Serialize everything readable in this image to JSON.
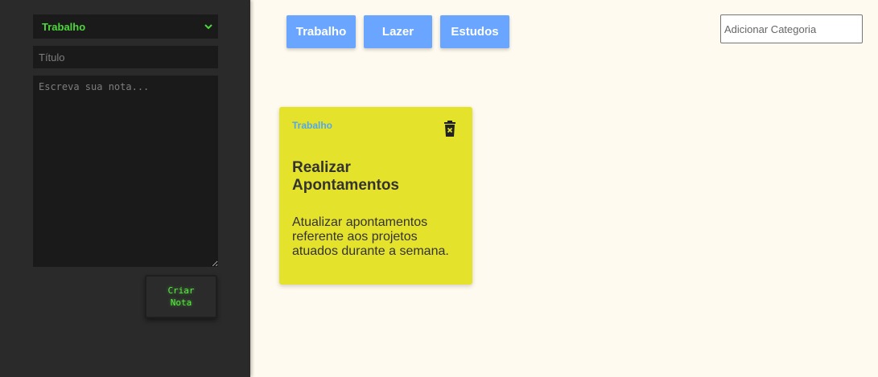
{
  "sidebar": {
    "category_select": {
      "value": "Trabalho",
      "options": [
        "Trabalho",
        "Lazer",
        "Estudos"
      ]
    },
    "title_input": {
      "placeholder": "Título",
      "value": ""
    },
    "note_textarea": {
      "placeholder": "Escreva sua nota...",
      "value": ""
    },
    "create_button": {
      "label": "Criar\nNota"
    }
  },
  "categories": {
    "buttons": [
      "Trabalho",
      "Lazer",
      "Estudos"
    ],
    "add_input": {
      "placeholder": "Adicionar Categoria",
      "value": ""
    }
  },
  "notes": [
    {
      "category": "Trabalho",
      "title": "Realizar Apontamentos",
      "body": "Atualizar apontamentos referente aos projetos atuados durante a semana."
    }
  ],
  "colors": {
    "sidebar_bg": "#2a2a2a",
    "accent_green": "#4cd83a",
    "category_button": "#6aa6ff",
    "note_card": "#e5e22b",
    "note_category_text": "#52a8e8",
    "page_bg": "#fffaef"
  },
  "icons": {
    "select_chevron": "chevron-down-icon",
    "note_delete": "trash-icon"
  }
}
